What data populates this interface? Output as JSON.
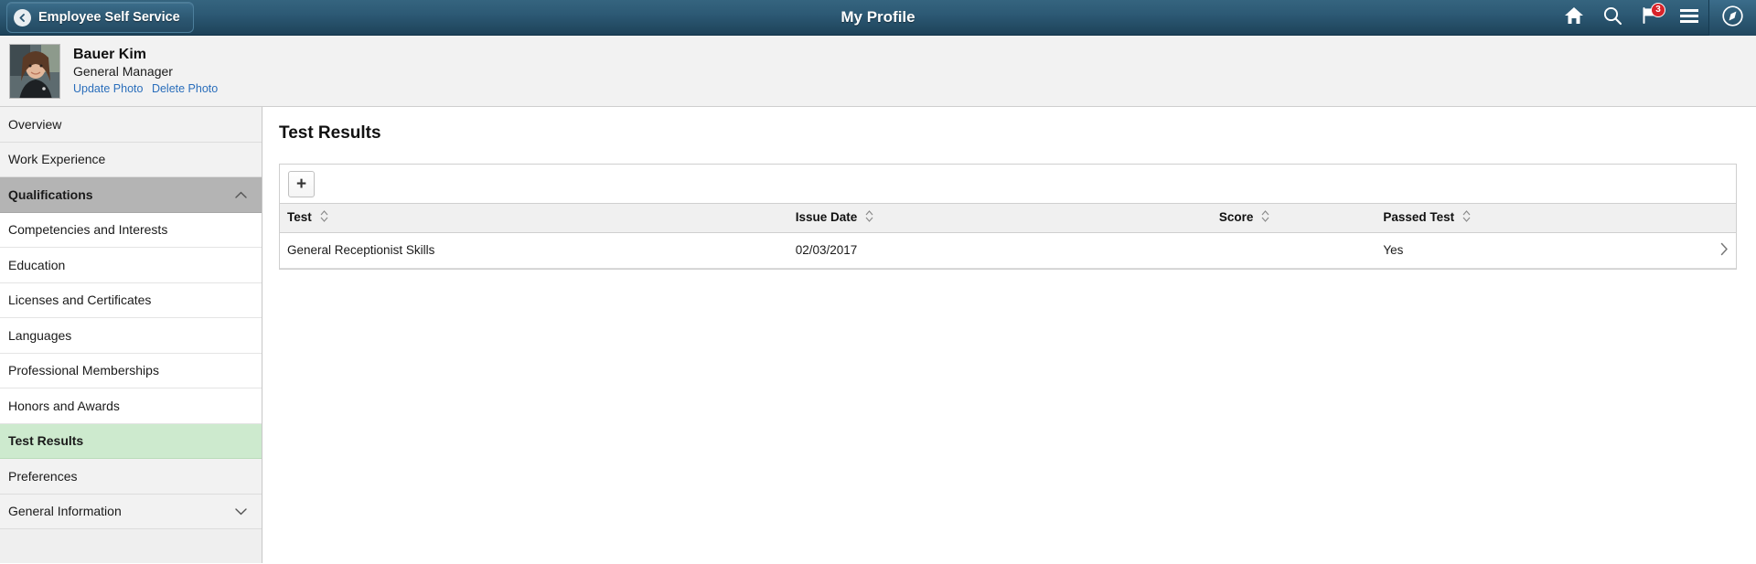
{
  "header": {
    "back_label": "Employee Self Service",
    "back_icon": "chevron-left-icon",
    "title": "My Profile",
    "icons": [
      {
        "name": "home-icon",
        "label": "Home"
      },
      {
        "name": "search-icon",
        "label": "Search"
      },
      {
        "name": "notifications-flag-icon",
        "label": "Notifications",
        "badge": "3"
      },
      {
        "name": "hamburger-menu-icon",
        "label": "Actions Menu"
      },
      {
        "name": "navigator-compass-icon",
        "label": "NavBar"
      }
    ],
    "badge_color": "#d8232a",
    "bar_color_top": "#35647f",
    "bar_color_bottom": "#1d4259"
  },
  "profile": {
    "name": "Bauer Kim",
    "role": "General Manager",
    "update_photo_label": "Update Photo",
    "delete_photo_label": "Delete Photo",
    "link_color": "#2a6ebb"
  },
  "sidebar": {
    "items": [
      {
        "label": "Overview",
        "type": "top",
        "state": "normal",
        "chevron": ""
      },
      {
        "label": "Work Experience",
        "type": "top",
        "state": "normal",
        "chevron": ""
      },
      {
        "label": "Qualifications",
        "type": "group",
        "state": "expanded",
        "chevron": "chevron-up-icon"
      },
      {
        "label": "Competencies and Interests",
        "type": "child",
        "state": "normal",
        "chevron": ""
      },
      {
        "label": "Education",
        "type": "child",
        "state": "normal",
        "chevron": ""
      },
      {
        "label": "Licenses and Certificates",
        "type": "child",
        "state": "normal",
        "chevron": ""
      },
      {
        "label": "Languages",
        "type": "child",
        "state": "normal",
        "chevron": ""
      },
      {
        "label": "Professional Memberships",
        "type": "child",
        "state": "normal",
        "chevron": ""
      },
      {
        "label": "Honors and Awards",
        "type": "child",
        "state": "normal",
        "chevron": ""
      },
      {
        "label": "Test Results",
        "type": "child",
        "state": "selected",
        "chevron": ""
      },
      {
        "label": "Preferences",
        "type": "top",
        "state": "normal",
        "chevron": ""
      },
      {
        "label": "General Information",
        "type": "top",
        "state": "collapsed",
        "chevron": "chevron-down-icon"
      }
    ],
    "selected_bg": "#cdeace",
    "group_bg": "#b4b4b4"
  },
  "main": {
    "page_title": "Test Results",
    "toolbar": {
      "add_label": "+",
      "add_name": "add-test-result-button"
    },
    "table": {
      "columns": [
        {
          "label": "Test",
          "sortable": true
        },
        {
          "label": "Issue Date",
          "sortable": true
        },
        {
          "label": "Score",
          "sortable": true
        },
        {
          "label": "Passed Test",
          "sortable": true
        }
      ],
      "rows": [
        {
          "test": "General Receptionist Skills",
          "issue_date": "02/03/2017",
          "score": "",
          "passed_test": "Yes",
          "chevron": "chevron-right-icon"
        }
      ]
    }
  }
}
